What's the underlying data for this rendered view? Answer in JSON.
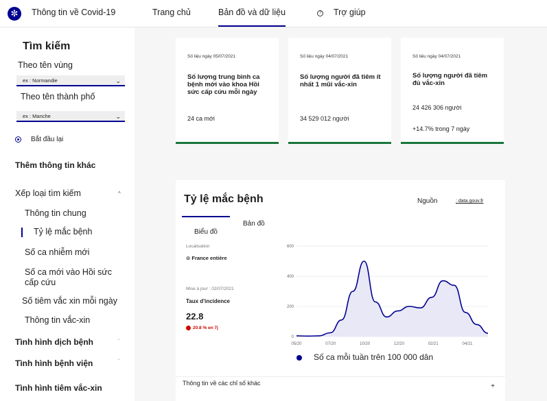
{
  "header": {
    "brand": "Thông tin về Covid-19",
    "nav": [
      "Trang chủ",
      "Bản đồ và dữ liệu",
      "Trợ giúp"
    ]
  },
  "sidebar": {
    "title": "Tìm kiếm",
    "region_label": "Theo tên vùng",
    "region_placeholder": "ex : Normandie",
    "city_label": "Theo tên thành phố",
    "city_placeholder": "ex : Manche",
    "reset": "Bắt đầu lại",
    "more": "Thêm thông tin khác",
    "rank": "Xếp loại tìm kiếm",
    "items": [
      "Thông tin chung",
      "Tỷ lệ mắc bệnh",
      "Số ca nhiễm mới",
      "Số ca mới vào Hồi sức cấp cứu",
      "Số tiêm vắc xin mỗi ngày",
      "Thông tin vắc-xin"
    ],
    "sections": [
      "Tình hình dịch bệnh",
      "Tình hình bệnh viện",
      "Tình hình tiêm vắc-xin"
    ]
  },
  "cards": [
    {
      "date": "Số liệu ngày 05/07/2021",
      "title": "Số lượng trung bình ca bệnh mới vào khoa Hồi sức cấp cứu mỗi ngày",
      "value": "24 ca mới"
    },
    {
      "date": "Số liệu ngày 04/07/2021",
      "title": "Số lượng người đã tiêm ít nhất 1 mũi vắc-xin",
      "value": "34 529 012 người"
    },
    {
      "date": "Số liệu ngày 04/07/2021",
      "title": "Số lượng người đã tiêm đủ vắc-xin",
      "value": "24 426 306 người",
      "trend": "+14.7% trong 7 ngày"
    }
  ],
  "panel": {
    "title": "Tỷ lệ mắc bệnh",
    "source_label": "Nguồn",
    "source_link": ": data.gouv.fr",
    "tabs": [
      "Biểu đồ",
      "Bản đồ"
    ],
    "loc_label": "Localisation",
    "loc_value": "France entière",
    "update": "Mise à jour : 02/07/2021",
    "metric": "Taux d'incidence",
    "value": "22.8",
    "change": "20.8 % en 7j",
    "other": "Thông tin về các chỉ số khác",
    "plus": "+"
  },
  "chart_data": {
    "type": "area",
    "x": [
      "05/20",
      "06/20",
      "07/20",
      "08/20",
      "09/20",
      "10/20",
      "10/20b",
      "11/20",
      "11/20b",
      "12/20",
      "01/21",
      "02/21",
      "03/21",
      "04/21",
      "04/21b",
      "05/21",
      "06/21",
      "07/21"
    ],
    "values": [
      5,
      3,
      5,
      25,
      110,
      300,
      500,
      230,
      130,
      170,
      200,
      190,
      260,
      370,
      340,
      160,
      80,
      22
    ],
    "xticks": [
      "05/20",
      "07/20",
      "10/20",
      "12/20",
      "02/21",
      "04/21"
    ],
    "yticks": [
      "0",
      "200",
      "400",
      "600"
    ],
    "ylim": [
      0,
      600
    ],
    "series_name": "Số ca mỗi tuần trên 100 000 dân",
    "color": "#000091"
  }
}
